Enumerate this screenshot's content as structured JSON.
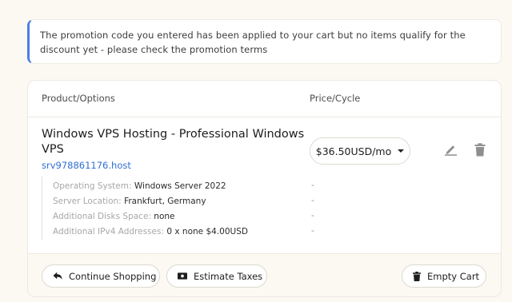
{
  "alert": {
    "message": "The promotion code you entered has been applied to your cart but no items qualify for the discount yet - please check the promotion terms",
    "accent_color": "#4a7ee8"
  },
  "cart": {
    "header": {
      "product_col": "Product/Options",
      "price_col": "Price/Cycle"
    },
    "item": {
      "name": "Windows VPS Hosting - Professional Windows VPS",
      "hostname": "srv978861176.host",
      "price": "$36.50USD/mo",
      "edit_icon": "pencil-icon",
      "delete_icon": "trash-icon",
      "options": [
        {
          "label": "Operating System:",
          "value": "Windows Server 2022",
          "price": "-"
        },
        {
          "label": "Server Location:",
          "value": "Frankfurt, Germany",
          "price": "-"
        },
        {
          "label": "Additional Disks Space:",
          "value": "none",
          "price": "-"
        },
        {
          "label": "Additional IPv4 Addresses:",
          "value": "0 x none $4.00USD",
          "price": "-"
        }
      ]
    },
    "footer": {
      "continue_label": "Continue Shopping",
      "taxes_label": "Estimate Taxes",
      "empty_label": "Empty Cart"
    }
  },
  "colors": {
    "link": "#2f6fd6",
    "background": "#fbf9f2"
  }
}
